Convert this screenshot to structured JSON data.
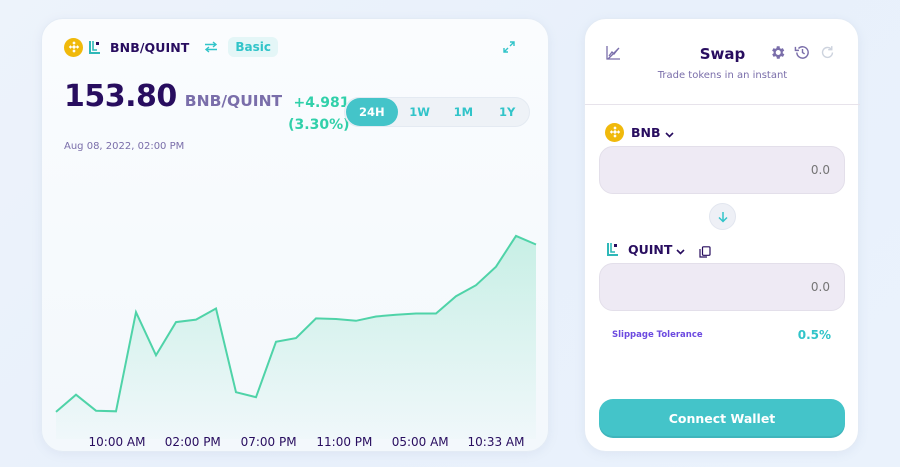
{
  "chart_panel": {
    "pair": "BNB/QUINT",
    "mode_badge": "Basic",
    "price": "153.80",
    "price_pair": "BNB/QUINT",
    "change_value": "+4.981",
    "change_percent": "(3.30%)",
    "date": "Aug 08, 2022, 02:00 PM",
    "range_tabs": [
      {
        "label": "24H",
        "active": true
      },
      {
        "label": "1W",
        "active": false
      },
      {
        "label": "1M",
        "active": false
      },
      {
        "label": "1Y",
        "active": false
      }
    ],
    "icons": {
      "base_token": "bnb-token-icon",
      "quote_token": "quint-token-icon",
      "switch": "swap-arrows-icon",
      "expand": "expand-icon"
    },
    "line_color": "#4fd3a8"
  },
  "chart_data": {
    "type": "area",
    "x_tick_labels": [
      "10:00 AM",
      "02:00 PM",
      "07:00 PM",
      "11:00 PM",
      "05:00 AM",
      "10:33 AM"
    ],
    "values": [
      146.8,
      148.2,
      146.9,
      146.85,
      154.9,
      151.4,
      154.1,
      154.3,
      155.2,
      148.4,
      148.0,
      152.5,
      152.8,
      154.4,
      154.35,
      154.2,
      154.55,
      154.7,
      154.8,
      154.8,
      156.2,
      157.1,
      158.6,
      161.1,
      160.4
    ],
    "title": "",
    "xlabel": "",
    "ylabel": "",
    "ylim": [
      144.6,
      164.1
    ],
    "grid": false,
    "legend": "none"
  },
  "swap_panel": {
    "title": "Swap",
    "subtitle": "Trade tokens in an instant",
    "from_token": "BNB",
    "from_amount_placeholder": "0.0",
    "to_token": "QUINT",
    "to_amount_placeholder": "0.0",
    "slippage_label": "Slippage Tolerance",
    "slippage_value": "0.5%",
    "connect_label": "Connect Wallet",
    "icons": {
      "chart_toggle": "chart-disabled-icon",
      "settings": "gear-icon",
      "history": "history-icon",
      "refresh": "refresh-icon",
      "switch": "arrow-down-icon",
      "copy": "copy-icon"
    },
    "accent": "#44c4c9"
  }
}
